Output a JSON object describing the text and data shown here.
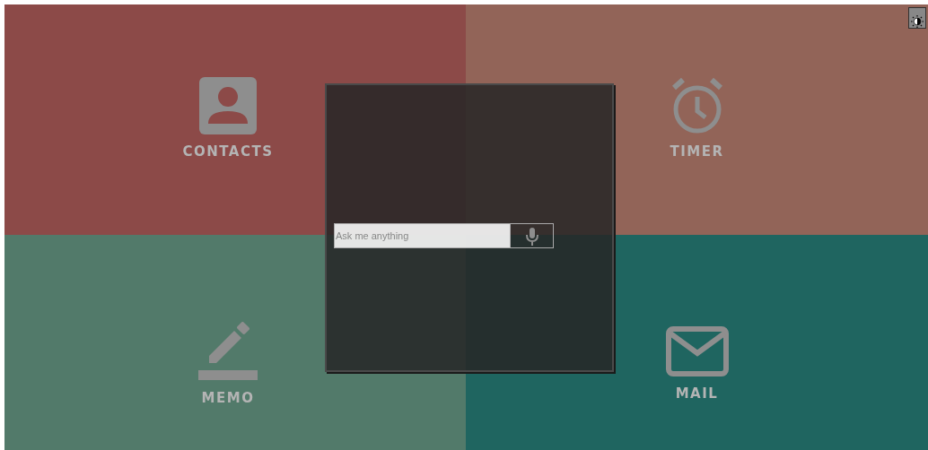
{
  "tiles": [
    {
      "label": "CONTACTS",
      "kind": "contacts",
      "color": "#8c4a48"
    },
    {
      "label": "TIMER",
      "kind": "timer",
      "color": "#926458"
    },
    {
      "label": "MEMO",
      "kind": "memo",
      "color": "#527a6a"
    },
    {
      "label": "MAIL",
      "kind": "mail",
      "color": "#1f6560"
    }
  ],
  "search": {
    "placeholder": "Ask me anything"
  }
}
